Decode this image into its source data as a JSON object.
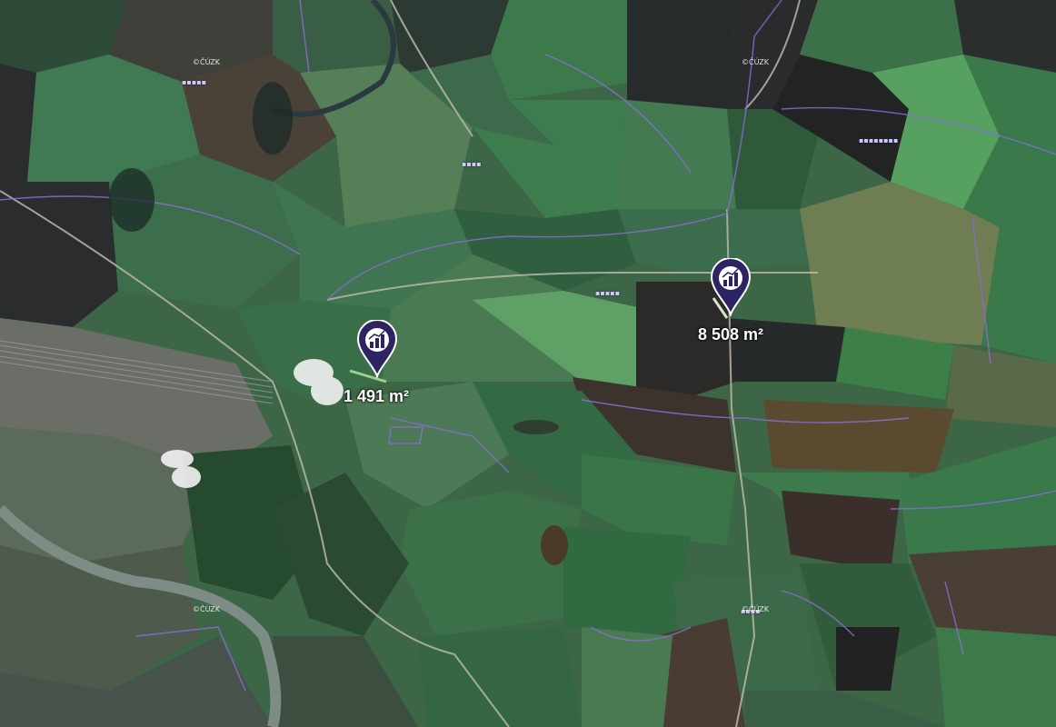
{
  "map": {
    "type": "satellite",
    "colors": {
      "field_dark_green": "#2f5a3a",
      "field_green": "#4a7a54",
      "field_light_green": "#5f9a66",
      "field_brown": "#4a3e34",
      "field_black": "#2a2b2c",
      "river": "#7e8c86",
      "parcel_boundary": "#8d6bd6",
      "marker": "#2c2463"
    },
    "markers": [
      {
        "icon": "building-chart-icon",
        "area_label": "1 491 m²"
      },
      {
        "icon": "building-chart-icon",
        "area_label": "8 508 m²"
      }
    ],
    "watermarks": [
      "©ČÚZK",
      "©ČÚZK",
      "©ČÚZK",
      "©ČÚZK"
    ]
  }
}
